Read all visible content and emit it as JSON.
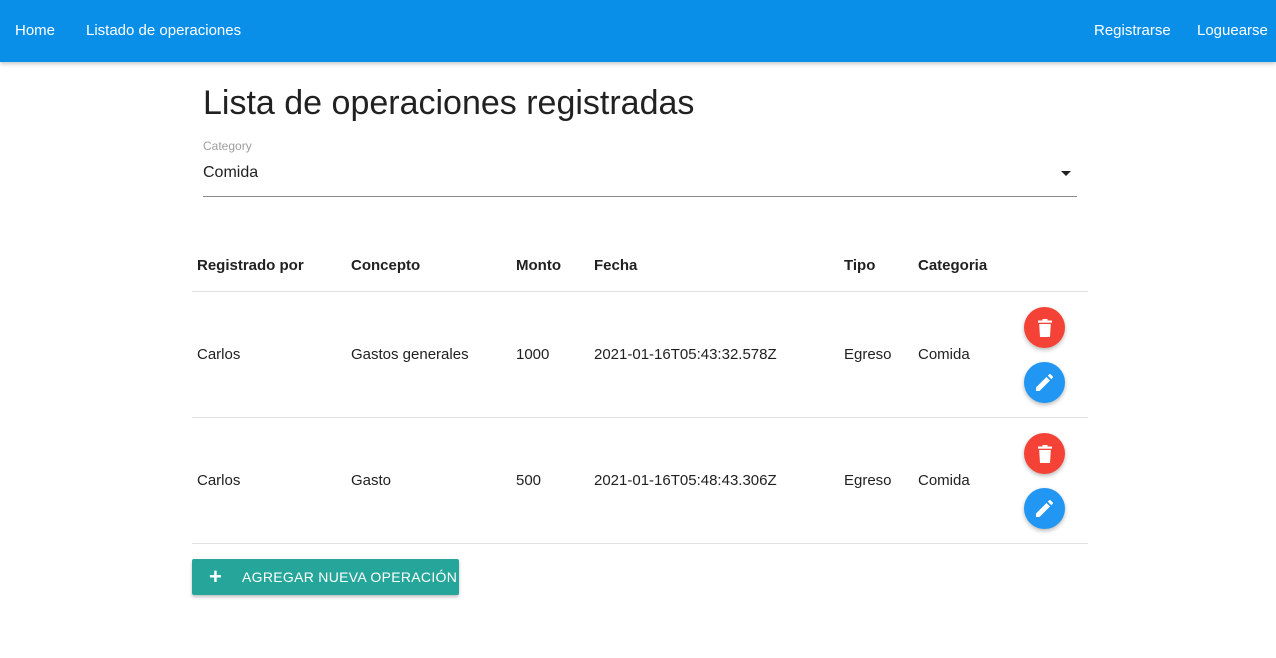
{
  "navbar": {
    "left_links": [
      "Home",
      "Listado de operaciones"
    ],
    "right_links": [
      "Registrarse",
      "Loguearse"
    ],
    "color": "#0a8fe8"
  },
  "main": {
    "title": "Lista de operaciones registradas",
    "category_select": {
      "label": "Category",
      "value": "Comida"
    },
    "table": {
      "headers": [
        "Registrado por",
        "Concepto",
        "Monto",
        "Fecha",
        "Tipo",
        "Categoria"
      ],
      "rows": [
        [
          "Carlos",
          "Gastos generales",
          "1000",
          "2021-01-16T05:43:32.578Z",
          "Egreso",
          "Comida"
        ],
        [
          "Carlos",
          "Gasto",
          "500",
          "2021-01-16T05:48:43.306Z",
          "Egreso",
          "Comida"
        ]
      ],
      "row_actions": [
        {
          "icon": "trash-icon",
          "color": "#f44336"
        },
        {
          "icon": "pencil-icon",
          "color": "#2196f3"
        }
      ]
    },
    "add_button": {
      "icon": "+",
      "label": "AGREGAR NUEVA OPERACIÓN",
      "color": "#26a69a"
    }
  }
}
